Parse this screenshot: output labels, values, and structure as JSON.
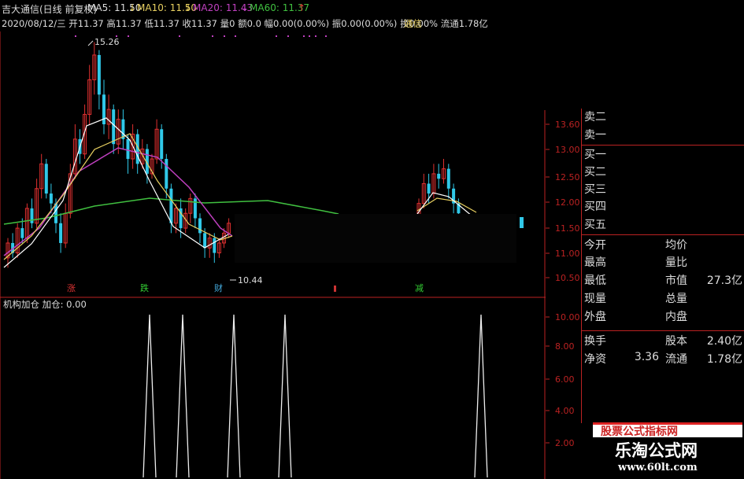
{
  "header": {
    "stock": "吉大通信(日线 前复权)",
    "ma5": "MA5: 11.50",
    "ma10": "MA10: 11.50",
    "ma20": "MA20: 11.43",
    "ma60": "MA60: 11.37",
    "info_line": "2020/08/12/三 开11.37 高11.37 低11.37 收11.37 量0 额0.0 幅0.00(0.00%) 振0.00(0.00%) 换0.00% 流通1.78亿",
    "info_tail": "通信"
  },
  "price_labels": {
    "high": "15.26",
    "low": "10.44"
  },
  "event_labels": [
    "涨",
    "跌",
    "财",
    "减"
  ],
  "price_axis": [
    "13.60",
    "13.00",
    "12.50",
    "12.00",
    "11.50",
    "11.00",
    "10.50"
  ],
  "indicator": {
    "title": "机构加仓 加仓: 0.00",
    "axis": [
      "10.00",
      "8.00",
      "6.00",
      "4.00",
      "2.00"
    ]
  },
  "quote_panel": {
    "sell": [
      "卖二",
      "卖一"
    ],
    "buy": [
      "买一",
      "买二",
      "买三",
      "买四",
      "买五"
    ],
    "stats": [
      {
        "l1": "今开",
        "v1": "",
        "l2": "均价",
        "v2": ""
      },
      {
        "l1": "最高",
        "v1": "",
        "l2": "量比",
        "v2": ""
      },
      {
        "l1": "最低",
        "v1": "",
        "l2": "市值",
        "v2": "27.3亿"
      },
      {
        "l1": "现量",
        "v1": "",
        "l2": "总量",
        "v2": ""
      },
      {
        "l1": "外盘",
        "v1": "",
        "l2": "内盘",
        "v2": ""
      }
    ],
    "stats2": [
      {
        "l1": "换手",
        "v1": "",
        "l2": "股本",
        "v2": "2.40亿"
      },
      {
        "l1": "净资",
        "v1": "3.36",
        "l2": "流通",
        "v2": "1.78亿"
      }
    ]
  },
  "watermark": {
    "banner": "股票公式指标网",
    "name": "乐淘公式网",
    "url": "www.60lt.com"
  },
  "colors": {
    "up": "#e03030",
    "down": "#30c8e8",
    "ma5": "#ffffff",
    "ma10": "#e8d060",
    "ma20": "#c040c0",
    "ma60": "#40c040"
  }
}
